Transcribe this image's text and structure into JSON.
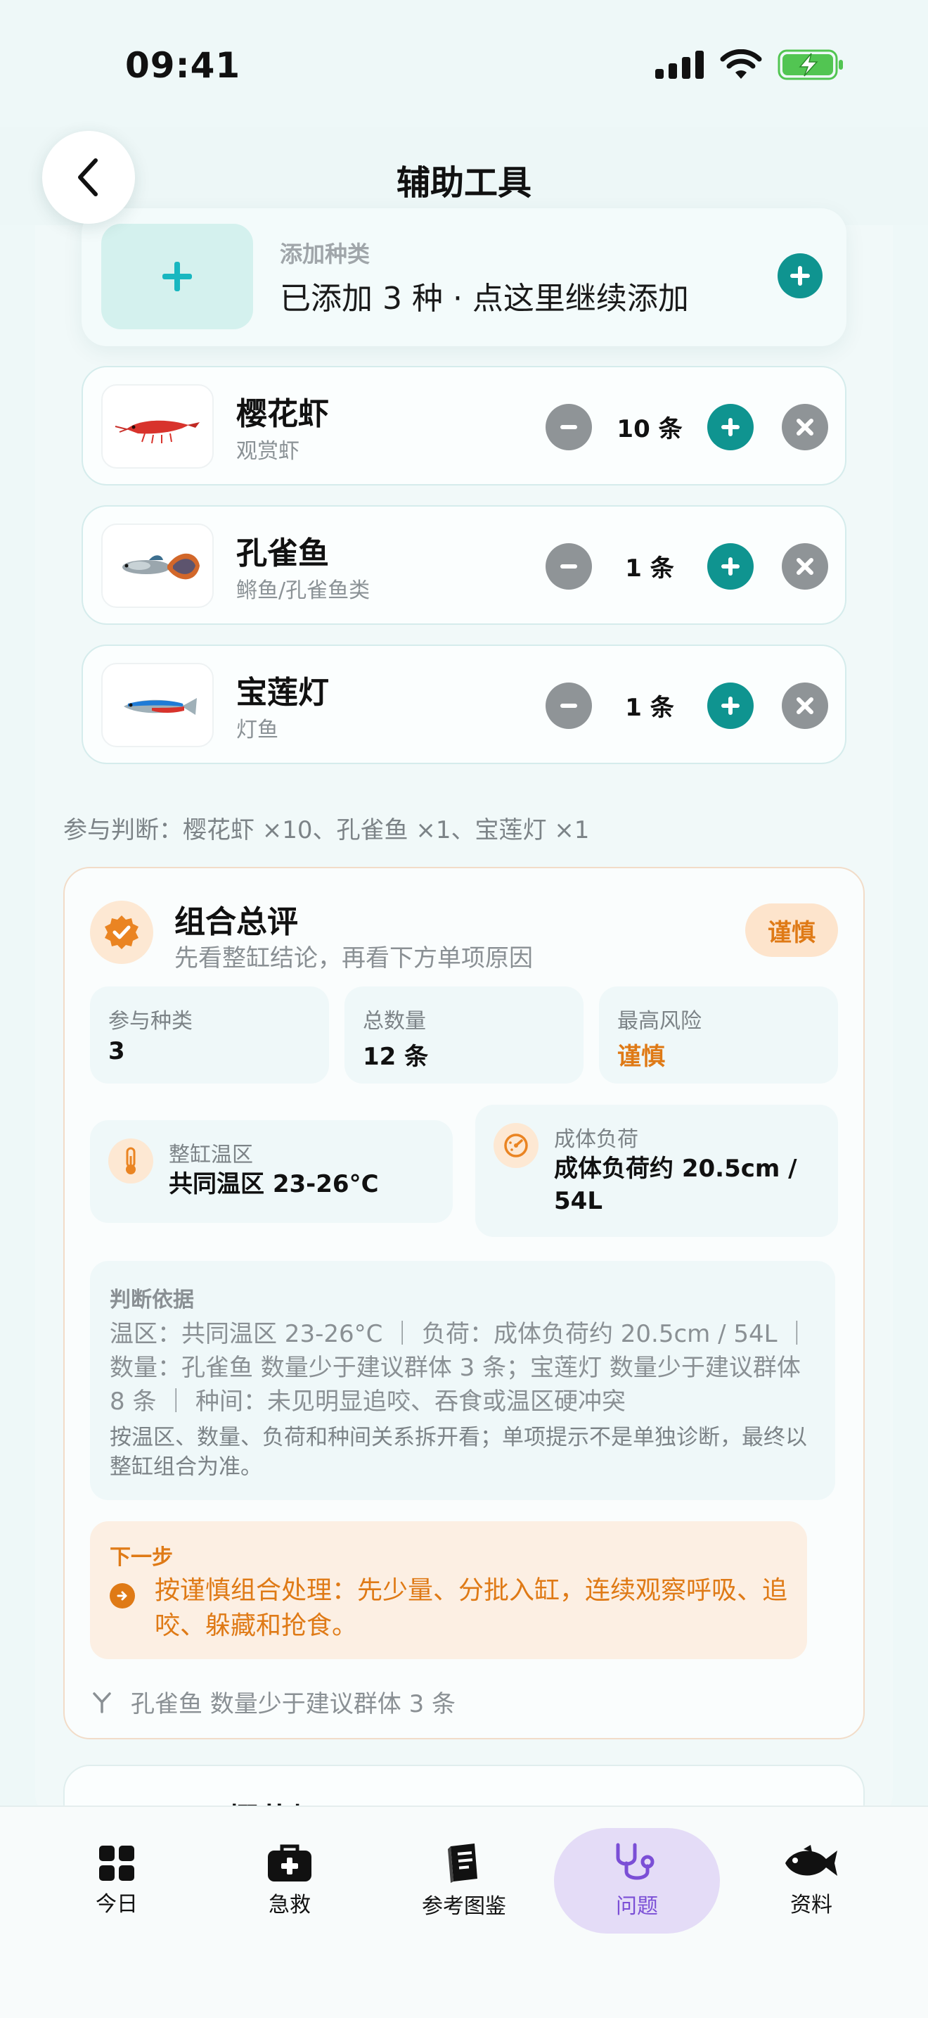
{
  "status_bar": {
    "time": "09:41"
  },
  "header": {
    "title": "辅助工具"
  },
  "add_card": {
    "small_label": "添加种类",
    "main_label": "已添加 3 种 · 点这里继续添加"
  },
  "species": [
    {
      "name": "樱花虾",
      "category": "观赏虾",
      "count": "10 条"
    },
    {
      "name": "孔雀鱼",
      "category": "鳉鱼/孔雀鱼类",
      "count": "1 条"
    },
    {
      "name": "宝莲灯",
      "category": "灯鱼",
      "count": "1 条"
    }
  ],
  "judge_line": "参与判断：樱花虾 ×10、孔雀鱼 ×1、宝莲灯 ×1",
  "summary": {
    "title": "组合总评",
    "subtitle": "先看整缸结论，再看下方单项原因",
    "badge": "谨慎",
    "stats": [
      {
        "label": "参与种类",
        "value": "3"
      },
      {
        "label": "总数量",
        "value": "12 条"
      },
      {
        "label": "最高风险",
        "value": "谨慎"
      }
    ],
    "temp": {
      "label": "整缸温区",
      "value": "共同温区 23-26°C"
    },
    "load": {
      "label": "成体负荷",
      "value_line1": "成体负荷约 20.5cm /",
      "value_line2": "54L"
    },
    "basis": {
      "heading": "判断依据",
      "text": "温区：共同温区 23-26°C ｜ 负荷：成体负荷约 20.5cm / 54L ｜ 数量：孔雀鱼 数量少于建议群体 3 条；宝莲灯 数量少于建议群体 8 条 ｜ 种间：未见明显追咬、吞食或温区硬冲突",
      "note": "按温区、数量、负荷和种间关系拆开看；单项提示不是单独诊断，最终以整缸组合为准。"
    },
    "next": {
      "heading": "下一步",
      "text": "按谨慎组合处理：先少量、分批入缸，连续观察呼吸、追咬、躲藏和抢食。"
    },
    "footnote": "孔雀鱼 数量少于建议群体 3 条"
  },
  "peek_card": {
    "name": "樱花虾"
  },
  "tabs": [
    {
      "label": "今日",
      "icon": "grid-icon"
    },
    {
      "label": "急救",
      "icon": "first-aid-kit-icon"
    },
    {
      "label": "参考图鉴",
      "icon": "book-icon"
    },
    {
      "label": "问题",
      "icon": "stethoscope-icon"
    },
    {
      "label": "资料",
      "icon": "fish-icon"
    }
  ],
  "colors": {
    "teal": "#0f9490",
    "warn": "#df7a16",
    "active_tab": "#7b4fd6"
  }
}
